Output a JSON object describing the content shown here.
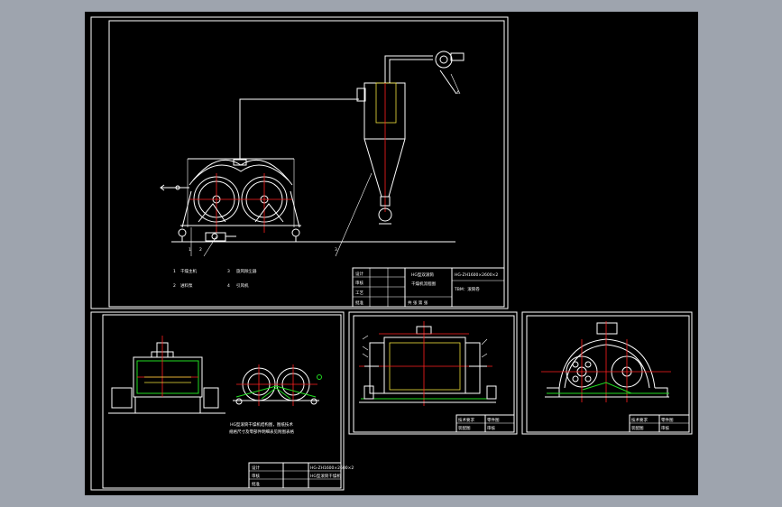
{
  "drawing": {
    "background_color": "#000000",
    "outer_color": "#9ea4ae",
    "line_color": "#ffffff",
    "center_line_color": "#ff2020",
    "hatch_color": "#22dd22"
  },
  "sheet_main": {
    "legend": [
      {
        "num": "1",
        "label": "干燥主机"
      },
      {
        "num": "3",
        "label": "旋风除尘器"
      },
      {
        "num": "2",
        "label": "进料泵"
      },
      {
        "num": "4",
        "label": "引风机"
      }
    ],
    "title_block": {
      "name_line1": "HG型双滚筒",
      "name_line2": "干燥机流程图",
      "drawing_no": "HG-ZH1600×2600×2",
      "unit": "TBM：滚筒卷",
      "scale_label": "比例",
      "sheet_label": "共 张 第 张",
      "rows": [
        "设计",
        "审核",
        "工艺",
        "批准"
      ]
    },
    "callouts": [
      "1",
      "2",
      "3",
      "4"
    ]
  },
  "sheet_assembly": {
    "note_line1": "HG型滚筒干燥机结构图，图纸技术",
    "note_line2": "规格尺寸及零部件明细表见附图表格",
    "title_block": {
      "name": "HG型滚筒干燥机",
      "drawing_no": "HG-ZH1600×2600×2",
      "rows": [
        "设计",
        "审核",
        "批准"
      ]
    }
  },
  "sheet_front": {
    "title_block": {
      "rows": [
        "技术要求",
        "装配图",
        "零件图",
        "审核"
      ]
    }
  },
  "sheet_side": {
    "title_block": {
      "rows": [
        "技术要求",
        "装配图",
        "零件图",
        "审核"
      ]
    }
  }
}
